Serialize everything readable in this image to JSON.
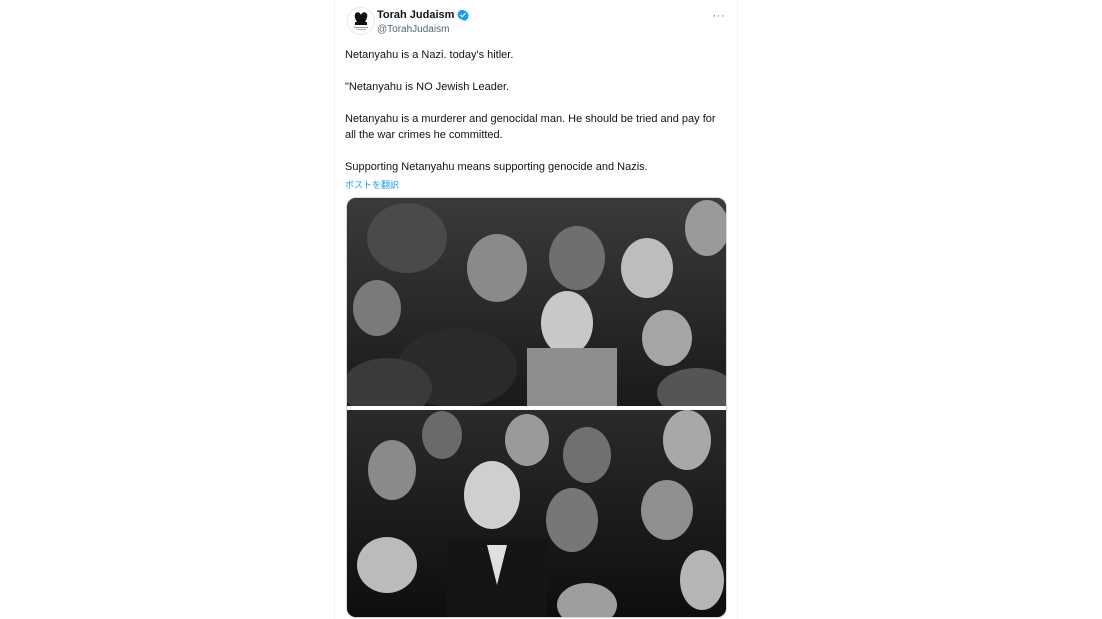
{
  "tweet": {
    "display_name": "Torah Judaism",
    "handle": "@TorahJudaism",
    "more_label": "···",
    "paragraphs": [
      "Netanyahu is a Nazi. today's hitler.",
      "\"Netanyahu is NO Jewish Leader.",
      "Netanyahu is a murderer and genocidal man. He should be tried and pay for all the war crimes he committed.",
      "Supporting Netanyahu means supporting genocide and Nazis."
    ],
    "translate_label": "ポストを翻訳"
  },
  "media": {
    "images": [
      {
        "name": "historical-crowd-photo",
        "style": "black-and-white"
      },
      {
        "name": "modern-crowd-photo",
        "style": "black-and-white"
      }
    ]
  },
  "colors": {
    "accent": "#1d9bf0",
    "text": "#0f1419",
    "secondary": "#536471"
  },
  "icons": {
    "verified": "verified-badge-icon",
    "more": "more-options-icon"
  }
}
